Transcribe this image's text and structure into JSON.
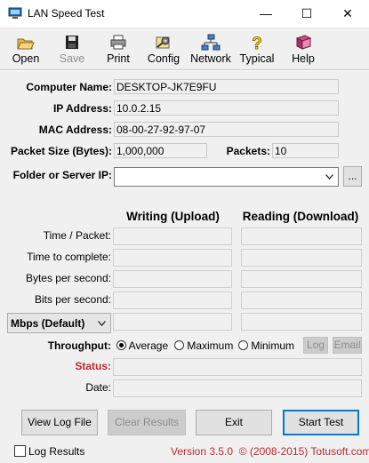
{
  "window": {
    "title": "LAN Speed Test",
    "minimize": "—",
    "maximize": "☐",
    "close": "✕"
  },
  "toolbar": [
    {
      "label": "Open",
      "icon": "open-folder-icon"
    },
    {
      "label": "Save",
      "icon": "floppy-disk-icon",
      "disabled": true
    },
    {
      "label": "Print",
      "icon": "printer-icon"
    },
    {
      "label": "Config",
      "icon": "config-icon"
    },
    {
      "label": "Network",
      "icon": "network-icon"
    },
    {
      "label": "Typical",
      "icon": "question-icon"
    },
    {
      "label": "Help",
      "icon": "help-book-icon"
    }
  ],
  "fields": {
    "computer_name_label": "Computer Name:",
    "computer_name": "DESKTOP-JK7E9FU",
    "ip_label": "IP Address:",
    "ip": "10.0.2.15",
    "mac_label": "MAC Address:",
    "mac": "08-00-27-92-97-07",
    "packet_size_label": "Packet Size (Bytes):",
    "packet_size": "1,000,000",
    "packets_label": "Packets:",
    "packets": "10",
    "folder_label": "Folder or Server IP:",
    "folder_value": "",
    "browse": "..."
  },
  "results": {
    "writing_header": "Writing (Upload)",
    "reading_header": "Reading (Download)",
    "rows": [
      "Time / Packet:",
      "Time to complete:",
      "Bytes per second:",
      "Bits per second:"
    ],
    "unit_select": "Mbps (Default)"
  },
  "throughput": {
    "label": "Throughput:",
    "options": [
      "Average",
      "Maximum",
      "Minimum"
    ],
    "selected": "Average",
    "log": "Log",
    "email": "Email"
  },
  "status_label": "Status:",
  "date_label": "Date:",
  "buttons": {
    "view_log": "View Log File",
    "clear": "Clear Results",
    "exit": "Exit",
    "start": "Start Test"
  },
  "footer": {
    "log_results": "Log Results",
    "version": "Version 3.5.0  © (2008-2015) Totusoft.com"
  },
  "colors": {
    "status_label": "#c0282d",
    "version_text": "#c0282d"
  }
}
